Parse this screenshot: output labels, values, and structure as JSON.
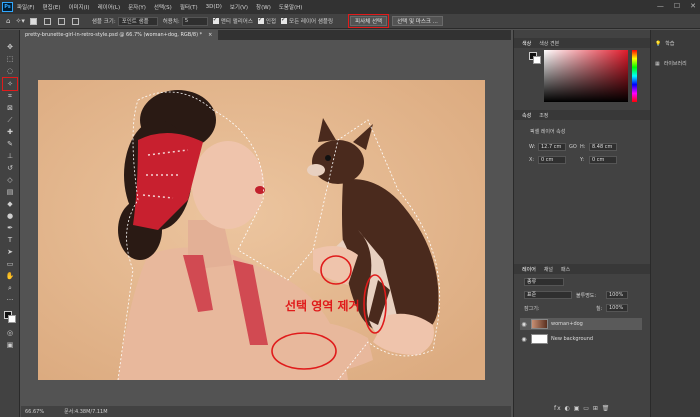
{
  "menubar": {
    "logo": "Ps",
    "items": [
      "파일(F)",
      "편집(E)",
      "이미지(I)",
      "레이어(L)",
      "문자(Y)",
      "선택(S)",
      "필터(T)",
      "3D(D)",
      "보기(V)",
      "창(W)",
      "도움말(H)"
    ],
    "win_min": "—",
    "win_max": "☐",
    "win_close": "✕"
  },
  "options": {
    "sample_label": "샘플 크기:",
    "sample_value": "포인트 샘플",
    "tolerance_label": "허용치:",
    "tolerance_value": "5",
    "antialias_label": "앤티 앨리어스",
    "contiguous_label": "인접",
    "all_layers_label": "모든 레이어 샘플링",
    "select_subject": "피사체 선택",
    "select_mask": "선택 및 마스크 ..."
  },
  "document": {
    "tab_title": "pretty-brunette-girl-in-retro-style.psd @ 66.7% (woman+dog, RGB/8) *",
    "close_symbol": "×",
    "annotation": "선택 영역 제거"
  },
  "status": {
    "zoom": "66.67%",
    "doc_size": "문서:4.38M/7.11M"
  },
  "color_panel": {
    "tab_active": "색상",
    "tab_other": "색상 견본"
  },
  "props_panel": {
    "tab_active": "속성",
    "tab_other": "조정",
    "heading": "픽셀 레이어 속성",
    "w_label": "W:",
    "w_value": "12.7 cm",
    "link": "GO",
    "h_label": "H:",
    "h_value": "8.48 cm",
    "x_label": "X:",
    "x_value": "0 cm",
    "y_label": "Y:",
    "y_value": "0 cm"
  },
  "layers_panel": {
    "tabs": [
      "레이어",
      "채널",
      "패스"
    ],
    "kind": "종류",
    "blend": "표준",
    "opacity_label": "불투명도:",
    "opacity_value": "100%",
    "lock_label": "잠그기:",
    "fill_label": "칠:",
    "fill_value": "100%",
    "layers": [
      {
        "name": "woman+dog"
      },
      {
        "name": "New background"
      }
    ],
    "bottom_icons": "fx  ◐  ▣  ▭  ⊞  🗑"
  },
  "far_right": {
    "learn": "학습",
    "libraries": "라이브러리"
  },
  "colors": {
    "accent_red": "#e01b1b",
    "canvas_bg": "#e6ba92"
  }
}
